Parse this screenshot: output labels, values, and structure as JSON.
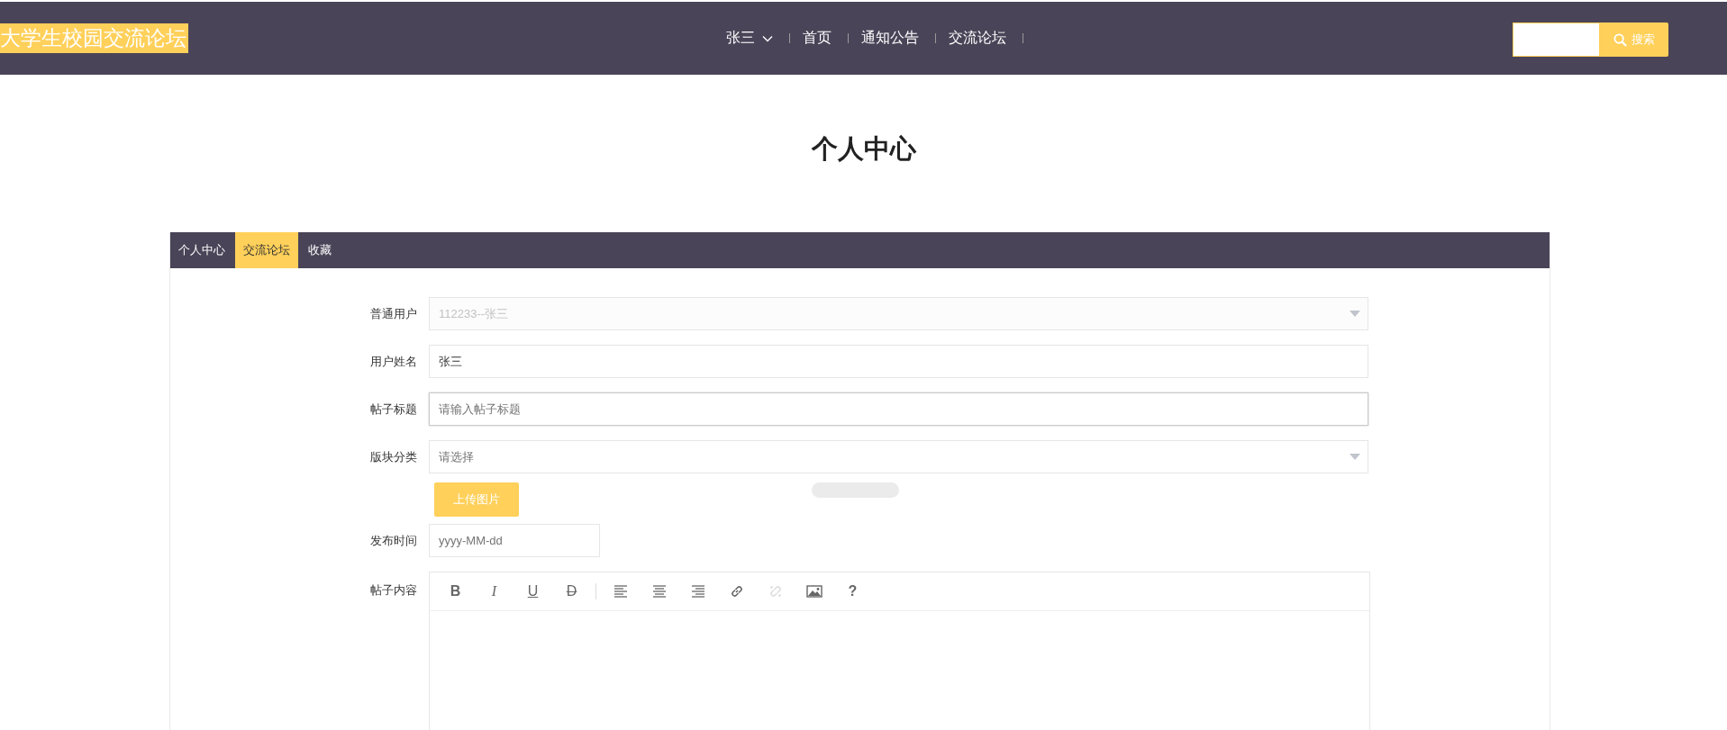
{
  "header": {
    "logo": "大学生校园交流论坛",
    "nav": [
      {
        "label": "张三",
        "kind": "dropdown"
      },
      {
        "label": "首页",
        "kind": "link"
      },
      {
        "label": "通知公告",
        "kind": "link"
      },
      {
        "label": "交流论坛",
        "kind": "link"
      }
    ],
    "search": {
      "button": "搜索"
    }
  },
  "page_title": "个人中心",
  "tabs": [
    {
      "label": "个人中心",
      "selected": false
    },
    {
      "label": "交流论坛",
      "selected": true
    },
    {
      "label": "收藏",
      "selected": false
    }
  ],
  "form": [
    {
      "kind": "select",
      "label": "普通用户",
      "value": "112233--张三",
      "disabled": true,
      "focused": false
    },
    {
      "kind": "text",
      "label": "用户姓名",
      "value": "张三",
      "disabled": false,
      "focused": false
    },
    {
      "kind": "text",
      "label": "帖子标题",
      "placeholder": "请输入帖子标题",
      "disabled": false,
      "focused": true
    },
    {
      "kind": "select",
      "label": "版块分类",
      "placeholder": "请选择",
      "disabled": false,
      "focused": false
    },
    {
      "kind": "upload",
      "button": "上传图片"
    },
    {
      "kind": "date",
      "label": "发布时间",
      "placeholder": "yyyy-MM-dd",
      "disabled": false,
      "focused": false
    },
    {
      "kind": "editor",
      "label": "帖子内容",
      "tools": [
        {
          "kind": "bold",
          "label": "B",
          "disabled": false
        },
        {
          "kind": "italic",
          "label": "I",
          "disabled": false
        },
        {
          "kind": "underline",
          "label": "U",
          "disabled": false
        },
        {
          "kind": "strike",
          "label": "D",
          "disabled": false
        },
        {
          "kind": "separator"
        },
        {
          "kind": "align-left",
          "disabled": false
        },
        {
          "kind": "align-center",
          "disabled": false
        },
        {
          "kind": "align-right",
          "disabled": false
        },
        {
          "kind": "link",
          "disabled": false
        },
        {
          "kind": "unlink",
          "disabled": true
        },
        {
          "kind": "image",
          "disabled": false
        },
        {
          "kind": "help",
          "label": "?",
          "disabled": false
        }
      ]
    }
  ]
}
